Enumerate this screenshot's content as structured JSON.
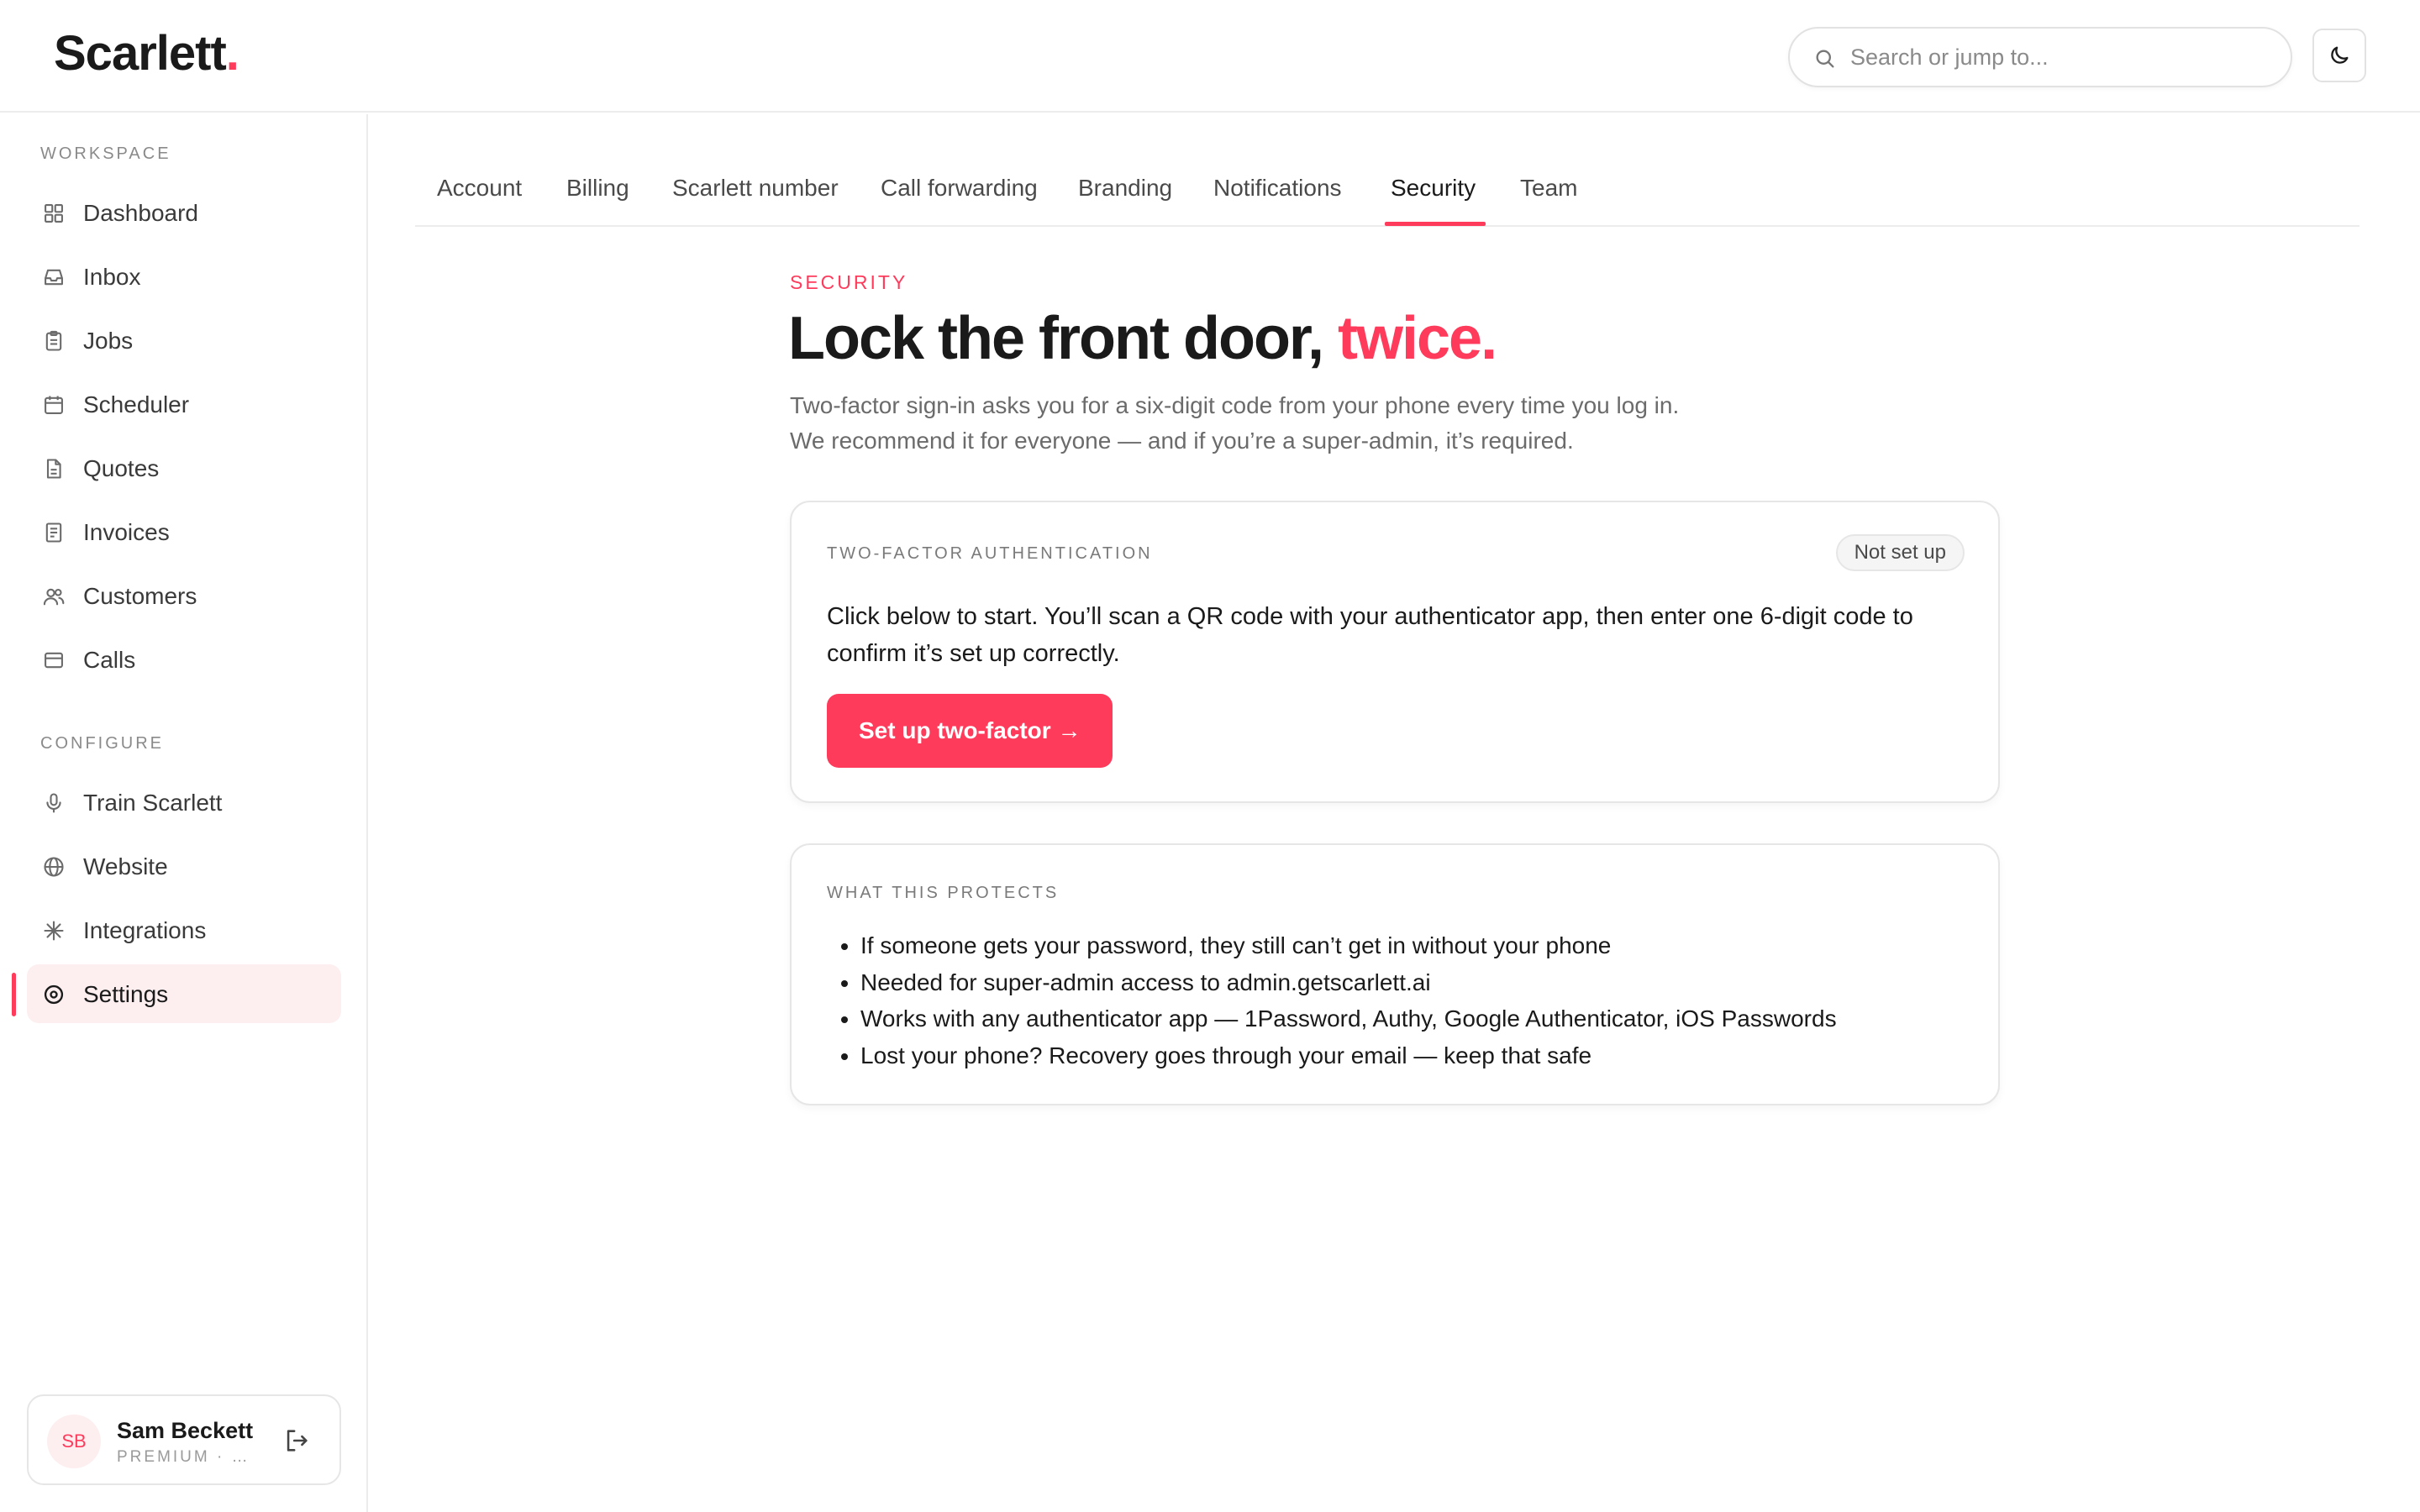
{
  "app": {
    "logo_text": "Scarlett",
    "logo_dot": "."
  },
  "header": {
    "search_placeholder": "Search or jump to...",
    "search_icon": "search-icon",
    "theme_icon": "moon-icon"
  },
  "sidebar": {
    "workspace_label": "WORKSPACE",
    "configure_label": "CONFIGURE",
    "workspace_items": [
      {
        "label": "Dashboard",
        "icon": "grid-icon"
      },
      {
        "label": "Inbox",
        "icon": "inbox-icon"
      },
      {
        "label": "Jobs",
        "icon": "clipboard-icon"
      },
      {
        "label": "Scheduler",
        "icon": "calendar-icon"
      },
      {
        "label": "Quotes",
        "icon": "document-icon"
      },
      {
        "label": "Invoices",
        "icon": "receipt-icon"
      },
      {
        "label": "Customers",
        "icon": "users-icon"
      },
      {
        "label": "Calls",
        "icon": "card-icon"
      }
    ],
    "configure_items": [
      {
        "label": "Train Scarlett",
        "icon": "microphone-icon"
      },
      {
        "label": "Website",
        "icon": "globe-icon"
      },
      {
        "label": "Integrations",
        "icon": "sparkle-icon"
      },
      {
        "label": "Settings",
        "icon": "settings-icon",
        "active": true
      }
    ]
  },
  "user": {
    "initials": "SB",
    "name": "Sam Beckett",
    "plan": "PREMIUM · S...",
    "logout_icon": "logout-icon"
  },
  "tabs": [
    {
      "label": "Account"
    },
    {
      "label": "Billing"
    },
    {
      "label": "Scarlett number"
    },
    {
      "label": "Call forwarding"
    },
    {
      "label": "Branding"
    },
    {
      "label": "Notifications"
    },
    {
      "label": "Security",
      "active": true
    },
    {
      "label": "Team"
    }
  ],
  "page": {
    "eyebrow": "SECURITY",
    "headline_main": "Lock the front door, ",
    "headline_accent": "twice.",
    "lede": "Two-factor sign-in asks you for a six-digit code from your phone every time you log in. We recommend it for everyone — and if you’re a super-admin, it’s required."
  },
  "two_factor_card": {
    "label": "TWO-FACTOR AUTHENTICATION",
    "status_badge": "Not set up",
    "body": "Click below to start. You’ll scan a QR code with your authenticator app, then enter one 6-digit code to confirm it’s set up correctly.",
    "button_label": "Set up two-factor →"
  },
  "protects_card": {
    "label": "WHAT THIS PROTECTS",
    "items": [
      "If someone gets your password, they still can’t get in without your phone",
      "Needed for super-admin access to admin.getscarlett.ai",
      "Works with any authenticator app — 1Password, Authy, Google Authenticator, iOS Passwords",
      "Lost your phone? Recovery goes through your email — keep that safe"
    ]
  },
  "colors": {
    "accent": "#ff3b5c",
    "active_nav_bg": "#fdeef0",
    "border": "#e6e6e6",
    "muted_text": "#6b6b6b"
  }
}
